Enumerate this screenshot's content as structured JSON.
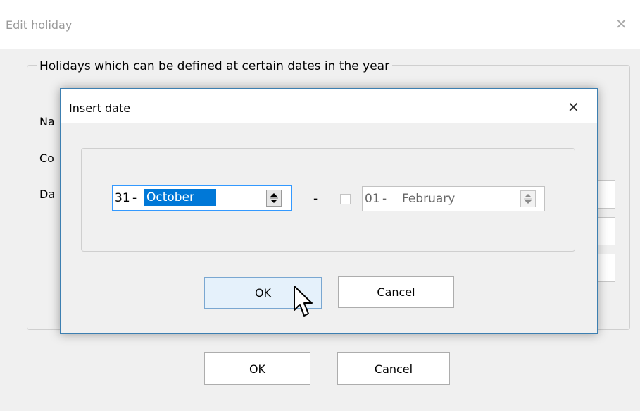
{
  "outer_dialog": {
    "title": "Edit holiday",
    "close_glyph": "✕",
    "group_label": "Holidays which can be defined at certain dates in the year",
    "label_1": "Na",
    "label_2": "Co",
    "label_3": "Da",
    "ok_label": "OK",
    "cancel_label": "Cancel"
  },
  "insert_date_dialog": {
    "title": "Insert date",
    "close_glyph": "✕",
    "start_date": {
      "day": "31",
      "separator": "-",
      "month": "October"
    },
    "range_separator": "-",
    "end_date_enabled": false,
    "end_date": {
      "day": "01",
      "separator": "-",
      "month": "February"
    },
    "ok_label": "OK",
    "cancel_label": "Cancel"
  },
  "colors": {
    "selection": "#0078d7",
    "focus_border": "#3399ff",
    "dialog_border": "#3c7fb1"
  },
  "icons": [
    "close-icon",
    "spin-up-down-icon",
    "mouse-pointer-icon"
  ]
}
